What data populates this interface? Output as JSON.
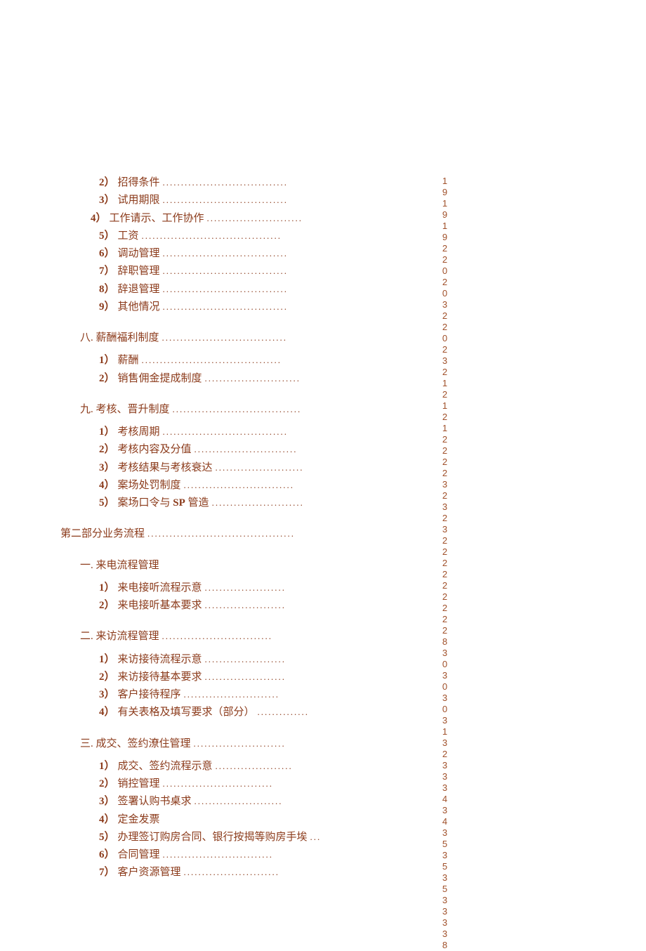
{
  "sections": [
    {
      "gap": false,
      "indent": 2,
      "items": [
        {
          "num": "2）",
          "label": "招得条件",
          "dots": 34
        },
        {
          "num": "3）",
          "label": "试用期限",
          "dots": 34
        }
      ]
    },
    {
      "gap": false,
      "indent": 2,
      "pre": "  ",
      "items": [
        {
          "num": "4）",
          "label": "工作请示、工作协作",
          "dots": 26,
          "numIndent": -12
        },
        {
          "num": "5）",
          "label": "工资",
          "dots": 38
        },
        {
          "num": "6）",
          "label": "调动管理",
          "dots": 34
        },
        {
          "num": "7）",
          "label": "辞职管理",
          "dots": 34
        },
        {
          "num": "8）",
          "label": "辞退管理",
          "dots": 34
        },
        {
          "num": "9）",
          "label": "其他情况",
          "dots": 34
        }
      ]
    },
    {
      "gap": true,
      "indent": 1,
      "header": {
        "label": "八. 薪酬福利制度",
        "dots": 34
      },
      "items": [
        {
          "num": "1）",
          "label": "薪酬",
          "dots": 38
        },
        {
          "num": "2）",
          "label": "销售佣金提成制度",
          "dots": 26
        }
      ]
    },
    {
      "gap": true,
      "indent": 1,
      "header": {
        "label": "九. 考核、晋升制度",
        "dots": 35
      },
      "items": [
        {
          "num": "1）",
          "label": "考核周期",
          "dots": 34
        },
        {
          "num": "2）",
          "label": "考核内容及分值",
          "dots": 28
        },
        {
          "num": "3）",
          "label": "考核结果与考核衰达",
          "dots": 24
        },
        {
          "num": "4）",
          "label": "案场处罚制度",
          "dots": 30
        },
        {
          "num": "5）",
          "label": "案场口令与 SP 管造",
          "dots": 25,
          "boldSp": true
        }
      ]
    },
    {
      "gap": true,
      "indent": 0,
      "header": {
        "label": "第二部分业务流程",
        "dots": 40
      }
    },
    {
      "gap": true,
      "indent": 1,
      "header": {
        "label": "一. 来电流程管理",
        "dots": 0
      },
      "items": [
        {
          "num": "1）",
          "label": "来电接听流程示意",
          "dots": 22
        },
        {
          "num": "2）",
          "label": "来电接听基本要求",
          "dots": 22
        }
      ]
    },
    {
      "gap": true,
      "indent": 1,
      "header": {
        "label": "二. 来访流程管理",
        "dots": 30
      },
      "items": [
        {
          "num": "1）",
          "label": "来访接待流程示意",
          "dots": 22
        },
        {
          "num": "2）",
          "label": "来访接待基本要求",
          "dots": 22
        },
        {
          "num": "3）",
          "label": "客户接待程序",
          "dots": 26
        },
        {
          "num": "4）",
          "label": "有关表格及填写要求（部分）",
          "dots": 14
        }
      ]
    },
    {
      "gap": true,
      "indent": 1,
      "header": {
        "label": "三. 成交、签约潦住管理",
        "dots": 25
      },
      "items": [
        {
          "num": "1）",
          "label": "成交、签约流程示意",
          "dots": 21
        },
        {
          "num": "2）",
          "label": "销控管理",
          "dots": 30
        },
        {
          "num": "3）",
          "label": "签署认购书桌求",
          "dots": 24
        },
        {
          "num": "4）",
          "label": "定金发票",
          "dots": 0
        },
        {
          "num": "5）",
          "label": "办理签订购房合同、银行按揭等购房手埃",
          "dots": 3
        },
        {
          "num": "6）",
          "label": "合同管理",
          "dots": 30
        },
        {
          "num": "7）",
          "label": "客户资源管理",
          "dots": 26
        }
      ]
    }
  ],
  "verticalText": "191919220203220232121212222323232222222228303030313233343435353533338"
}
